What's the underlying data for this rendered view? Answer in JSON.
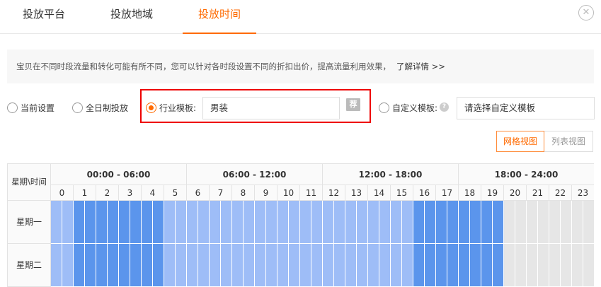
{
  "tabs": [
    {
      "label": "投放平台",
      "active": false
    },
    {
      "label": "投放地域",
      "active": false
    },
    {
      "label": "投放时间",
      "active": true
    }
  ],
  "close_icon": "close-circle-icon",
  "notice": {
    "text": "宝贝在不同时段流量和转化可能有所不同，您可以针对各时段设置不同的折扣出价，提高流量利用效果，",
    "link": "了解详情 >>"
  },
  "options": {
    "current": "当前设置",
    "all_day": "全日制投放",
    "industry": "行业模板:",
    "industry_value": "男装",
    "recommend_badge": "荐",
    "custom": "自定义模板:",
    "custom_placeholder": "请选择自定义模板",
    "selected": "industry"
  },
  "views": {
    "grid": "网格视图",
    "list": "列表视图",
    "active": "grid"
  },
  "schedule": {
    "corner": "星期\\时间",
    "ranges": [
      "00:00 - 06:00",
      "06:00 - 12:00",
      "12:00 - 18:00",
      "18:00 - 24:00"
    ],
    "hours": [
      "0",
      "1",
      "2",
      "3",
      "4",
      "5",
      "6",
      "7",
      "8",
      "9",
      "10",
      "11",
      "12",
      "13",
      "14",
      "15",
      "16",
      "17",
      "18",
      "19",
      "20",
      "21",
      "22",
      "23"
    ],
    "days": [
      {
        "label": "星期一",
        "levels": [
          1,
          1,
          2,
          2,
          2,
          2,
          2,
          2,
          2,
          2,
          1,
          1,
          1,
          1,
          1,
          1,
          1,
          1,
          1,
          1,
          1,
          1,
          1,
          1,
          1,
          1,
          1,
          1,
          1,
          1,
          1,
          1,
          2,
          2,
          2,
          2,
          2,
          2,
          2,
          2,
          0,
          0,
          0,
          0,
          0,
          0,
          0,
          0,
          0,
          0,
          0,
          0,
          0,
          0,
          0,
          0,
          0,
          0,
          3,
          3,
          3,
          3,
          3,
          3,
          3,
          3,
          3,
          3,
          3,
          3,
          4,
          4,
          4,
          4,
          4,
          4,
          4,
          4,
          4,
          4,
          4,
          4,
          3,
          3,
          3,
          3,
          3,
          3,
          3,
          3,
          3,
          3,
          3,
          3,
          3,
          3,
          4,
          4
        ]
      },
      {
        "label": "星期二",
        "levels": [
          1,
          1,
          2,
          2,
          2,
          2,
          2,
          2,
          2,
          2,
          1,
          1,
          1,
          1,
          1,
          1,
          1,
          1,
          1,
          1,
          1,
          1,
          1,
          1,
          1,
          1,
          1,
          1,
          1,
          1,
          1,
          1,
          2,
          2,
          2,
          2,
          2,
          2,
          2,
          2,
          0,
          0,
          0,
          0,
          0,
          0,
          0,
          0,
          0,
          0,
          0,
          0,
          0,
          0,
          0,
          0,
          0,
          0,
          3,
          3,
          3,
          3,
          3,
          3,
          3,
          3,
          3,
          3,
          3,
          3,
          4,
          4,
          4,
          4,
          4,
          4,
          4,
          4,
          4,
          4,
          4,
          4,
          3,
          3,
          3,
          3,
          3,
          3,
          3,
          3,
          3,
          3,
          3,
          3,
          3,
          3,
          4,
          4
        ]
      }
    ],
    "level_colors": [
      "#e6e6e6",
      "#9ebdf7",
      "#5b95ec",
      "#fde9a6",
      "#2f74e6"
    ]
  }
}
